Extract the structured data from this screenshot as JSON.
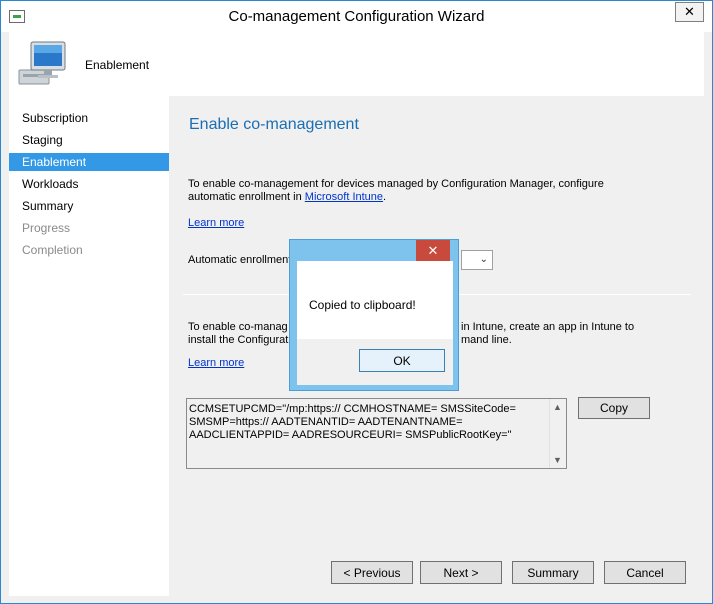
{
  "window": {
    "title": "Co-management Configuration Wizard",
    "close_glyph": "✕"
  },
  "header": {
    "title": "Enablement",
    "icon": "computer-monitor-icon"
  },
  "sidebar": {
    "items": [
      {
        "label": "Subscription",
        "state": "normal"
      },
      {
        "label": "Staging",
        "state": "normal"
      },
      {
        "label": "Enablement",
        "state": "active"
      },
      {
        "label": "Workloads",
        "state": "normal"
      },
      {
        "label": "Summary",
        "state": "normal"
      },
      {
        "label": "Progress",
        "state": "disabled"
      },
      {
        "label": "Completion",
        "state": "disabled"
      }
    ]
  },
  "main": {
    "section_title": "Enable co-management",
    "intro_text": "To enable co-management for devices managed by Configuration Manager, configure automatic enrollment in ",
    "intro_link": "Microsoft Intune",
    "intro_end": ".",
    "learn_more_1": "Learn more",
    "auto_enroll_label": "Automatic enrollment",
    "combo_arrow": "⌄",
    "cmd_intro_line1_left": "To enable co-manag",
    "cmd_intro_line1_right": "in Intune, create an app in Intune to",
    "cmd_intro_line2_left": "install the Configurat",
    "cmd_intro_line2_right": "mand line.",
    "learn_more_2": "Learn more",
    "command_text": "CCMSETUPCMD=\"/mp:https:// CCMHOSTNAME= SMSSiteCode= SMSMP=https:// AADTENANTID= AADTENANTNAME= AADCLIENTAPPID= AADRESOURCEURI= SMSPublicRootKey=\"",
    "copy_label": "Copy"
  },
  "footer": {
    "previous_label": "< Previous",
    "next_label": "Next >",
    "summary_label": "Summary",
    "cancel_label": "Cancel"
  },
  "dialog": {
    "message": "Copied to clipboard!",
    "ok_label": "OK",
    "close_glyph": "✕"
  },
  "colors": {
    "accent": "#3399e6",
    "section_title": "#1a6eb3",
    "link": "#0033cc",
    "dialog_frame": "#7ec3ee",
    "dialog_close": "#c74a3c"
  }
}
